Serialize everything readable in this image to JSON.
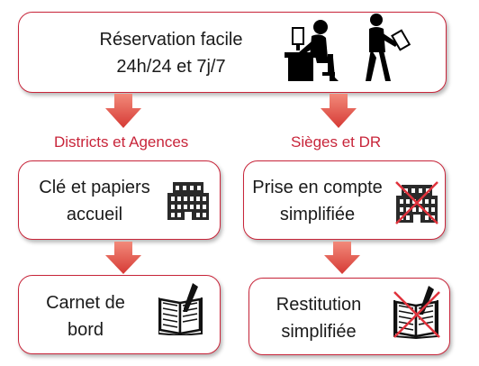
{
  "top": {
    "line1": "Réservation facile",
    "line2": "24h/24 et 7j/7"
  },
  "left_header": "Districts et Agences",
  "right_header": "Sièges et DR",
  "left": [
    {
      "line1": "Clé et papiers",
      "line2": "accueil"
    },
    {
      "line1": "Carnet de",
      "line2": "bord"
    }
  ],
  "right": [
    {
      "line1": "Prise en compte",
      "line2": "simplifiée"
    },
    {
      "line1": "Restitution",
      "line2": "simplifiée"
    }
  ],
  "icons": {
    "top": [
      "person-at-desk-icon",
      "walking-person-with-tablet-icon"
    ],
    "left": [
      "building-icon",
      "logbook-icon"
    ],
    "right": [
      "building-crossed-icon",
      "logbook-crossed-icon"
    ]
  },
  "colors": {
    "accent": "#c8253a",
    "arrow_top": "#ef6f5f",
    "arrow_bottom": "#c9232b",
    "cross": "#e0323c"
  }
}
